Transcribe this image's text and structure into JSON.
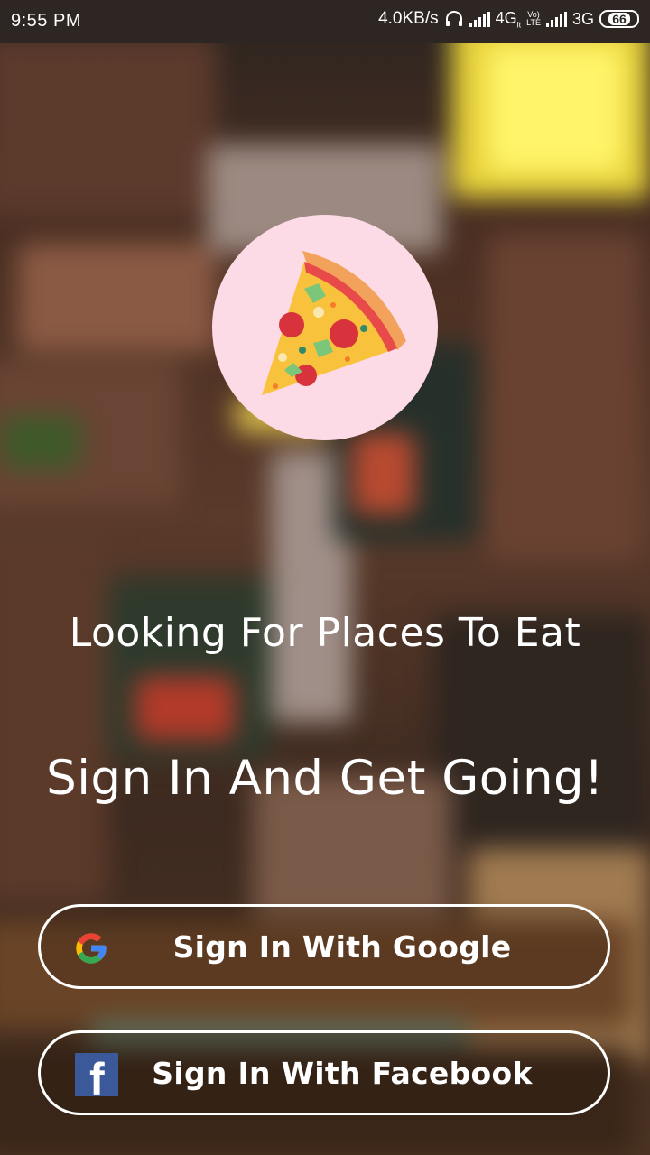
{
  "status_bar": {
    "time": "9:55 PM",
    "net_speed": "4.0KB/s",
    "network_1": "4G",
    "network_1_sub": "lt",
    "volte_top": "Vo)",
    "volte_bottom": "LTE",
    "network_2": "3G",
    "battery": "66",
    "icons": [
      "headphone-icon",
      "signal-icon",
      "signal-icon"
    ]
  },
  "logo": {
    "icon": "pizza-slice-icon",
    "circle_color": "#fddbe6"
  },
  "tagline": "Looking For Places To Eat",
  "headline": "Sign In And Get Going!",
  "buttons": {
    "google": {
      "label": "Sign In With Google",
      "icon": "google-icon"
    },
    "facebook": {
      "label": "Sign In With Facebook",
      "icon": "facebook-icon",
      "icon_letter": "f"
    }
  },
  "colors": {
    "text": "#ffffff",
    "facebook_blue": "#3b5998",
    "google_blue": "#4285f4",
    "google_red": "#ea4335",
    "google_yellow": "#fbbc05",
    "google_green": "#34a853"
  }
}
